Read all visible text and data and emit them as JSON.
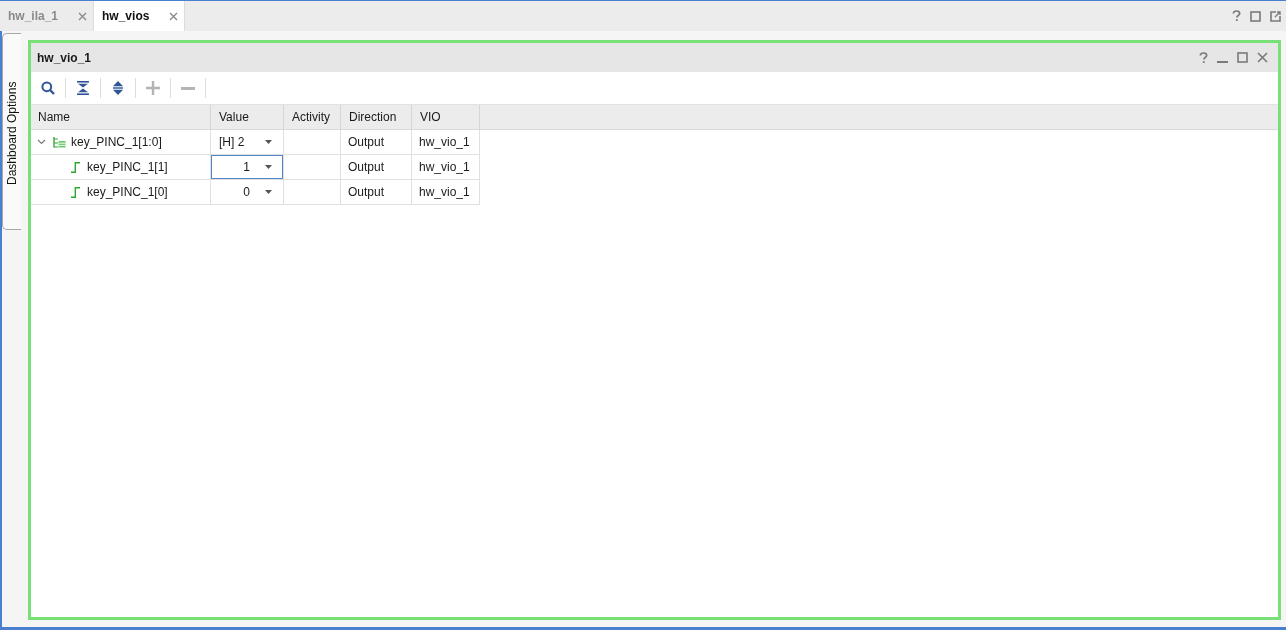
{
  "window_tabs": [
    {
      "label": "hw_ila_1",
      "selected": false
    },
    {
      "label": "hw_vios",
      "selected": true
    }
  ],
  "side_tab": {
    "label": "Dashboard Options"
  },
  "panel": {
    "title": "hw_vio_1",
    "toolbar": [
      {
        "kind": "search",
        "disabled": false
      },
      {
        "kind": "collapse_all",
        "disabled": false
      },
      {
        "kind": "expand_all",
        "disabled": false
      },
      {
        "kind": "add",
        "disabled": true
      },
      {
        "kind": "remove",
        "disabled": true
      }
    ],
    "table": {
      "columns": [
        "Name",
        "Value",
        "Activity",
        "Direction",
        "VIO"
      ],
      "rows": [
        {
          "name": "key_PINC_1[1:0]",
          "kind": "bus",
          "expanded": true,
          "value": "[H] 2",
          "focused": false,
          "direction": "Output",
          "vio": "hw_vio_1",
          "children": [
            {
              "name": "key_PINC_1[1]",
              "kind": "bit",
              "value": "1",
              "focused": true,
              "direction": "Output",
              "vio": "hw_vio_1"
            },
            {
              "name": "key_PINC_1[0]",
              "kind": "bit",
              "value": "0",
              "focused": false,
              "direction": "Output",
              "vio": "hw_vio_1"
            }
          ]
        }
      ]
    }
  }
}
